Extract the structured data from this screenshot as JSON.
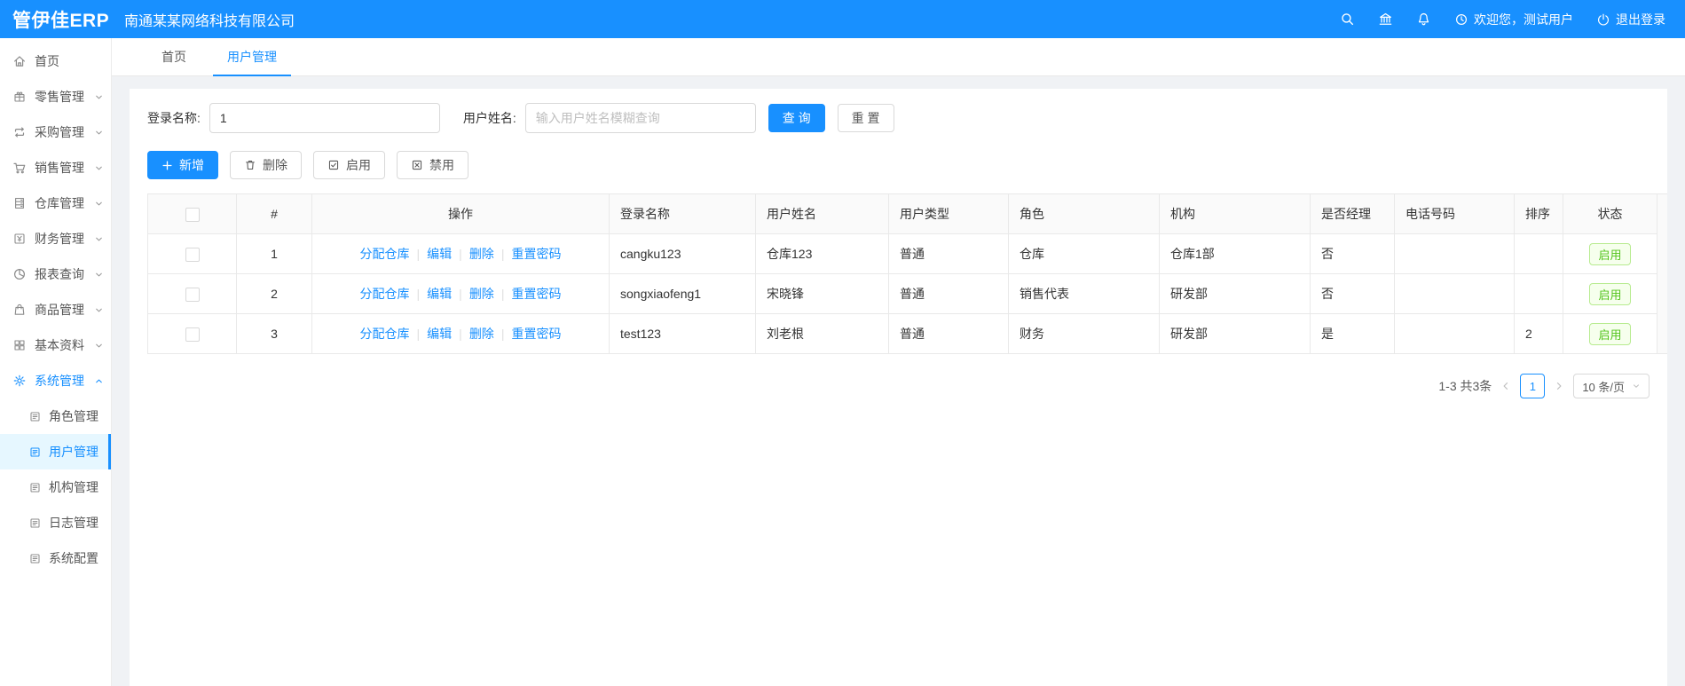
{
  "header": {
    "logo": "管伊佳ERP",
    "company": "南通某某网络科技有限公司",
    "welcome": "欢迎您，测试用户",
    "logout": "退出登录"
  },
  "tabs": [
    {
      "label": "首页"
    },
    {
      "label": "用户管理"
    }
  ],
  "sidebar": {
    "items": [
      {
        "label": "首页"
      },
      {
        "label": "零售管理"
      },
      {
        "label": "采购管理"
      },
      {
        "label": "销售管理"
      },
      {
        "label": "仓库管理"
      },
      {
        "label": "财务管理"
      },
      {
        "label": "报表查询"
      },
      {
        "label": "商品管理"
      },
      {
        "label": "基本资料"
      },
      {
        "label": "系统管理"
      }
    ],
    "sub_items": [
      {
        "label": "角色管理"
      },
      {
        "label": "用户管理"
      },
      {
        "label": "机构管理"
      },
      {
        "label": "日志管理"
      },
      {
        "label": "系统配置"
      }
    ]
  },
  "search": {
    "login_label": "登录名称:",
    "login_value": "1",
    "name_label": "用户姓名:",
    "name_placeholder": "输入用户姓名模糊查询",
    "query_button": "查 询",
    "reset_button": "重 置"
  },
  "toolbar": {
    "add": "新增",
    "delete": "删除",
    "enable": "启用",
    "disable": "禁用"
  },
  "table": {
    "columns": [
      "#",
      "操作",
      "登录名称",
      "用户姓名",
      "用户类型",
      "角色",
      "机构",
      "是否经理",
      "电话号码",
      "排序",
      "状态"
    ],
    "action_links": [
      "分配仓库",
      "编辑",
      "删除",
      "重置密码"
    ],
    "rows": [
      {
        "index": "1",
        "login": "cangku123",
        "name": "仓库123",
        "type": "普通",
        "role": "仓库",
        "org": "仓库1部",
        "manager": "否",
        "phone": "",
        "sort": "",
        "status": "启用"
      },
      {
        "index": "2",
        "login": "songxiaofeng1",
        "name": "宋晓锋",
        "type": "普通",
        "role": "销售代表",
        "org": "研发部",
        "manager": "否",
        "phone": "",
        "sort": "",
        "status": "启用"
      },
      {
        "index": "3",
        "login": "test123",
        "name": "刘老根",
        "type": "普通",
        "role": "财务",
        "org": "研发部",
        "manager": "是",
        "phone": "",
        "sort": "2",
        "status": "启用"
      }
    ]
  },
  "pagination": {
    "total": "1-3 共3条",
    "page": "1",
    "page_size": "10 条/页"
  },
  "colors": {
    "primary": "#1890ff",
    "success": "#52c41a"
  }
}
